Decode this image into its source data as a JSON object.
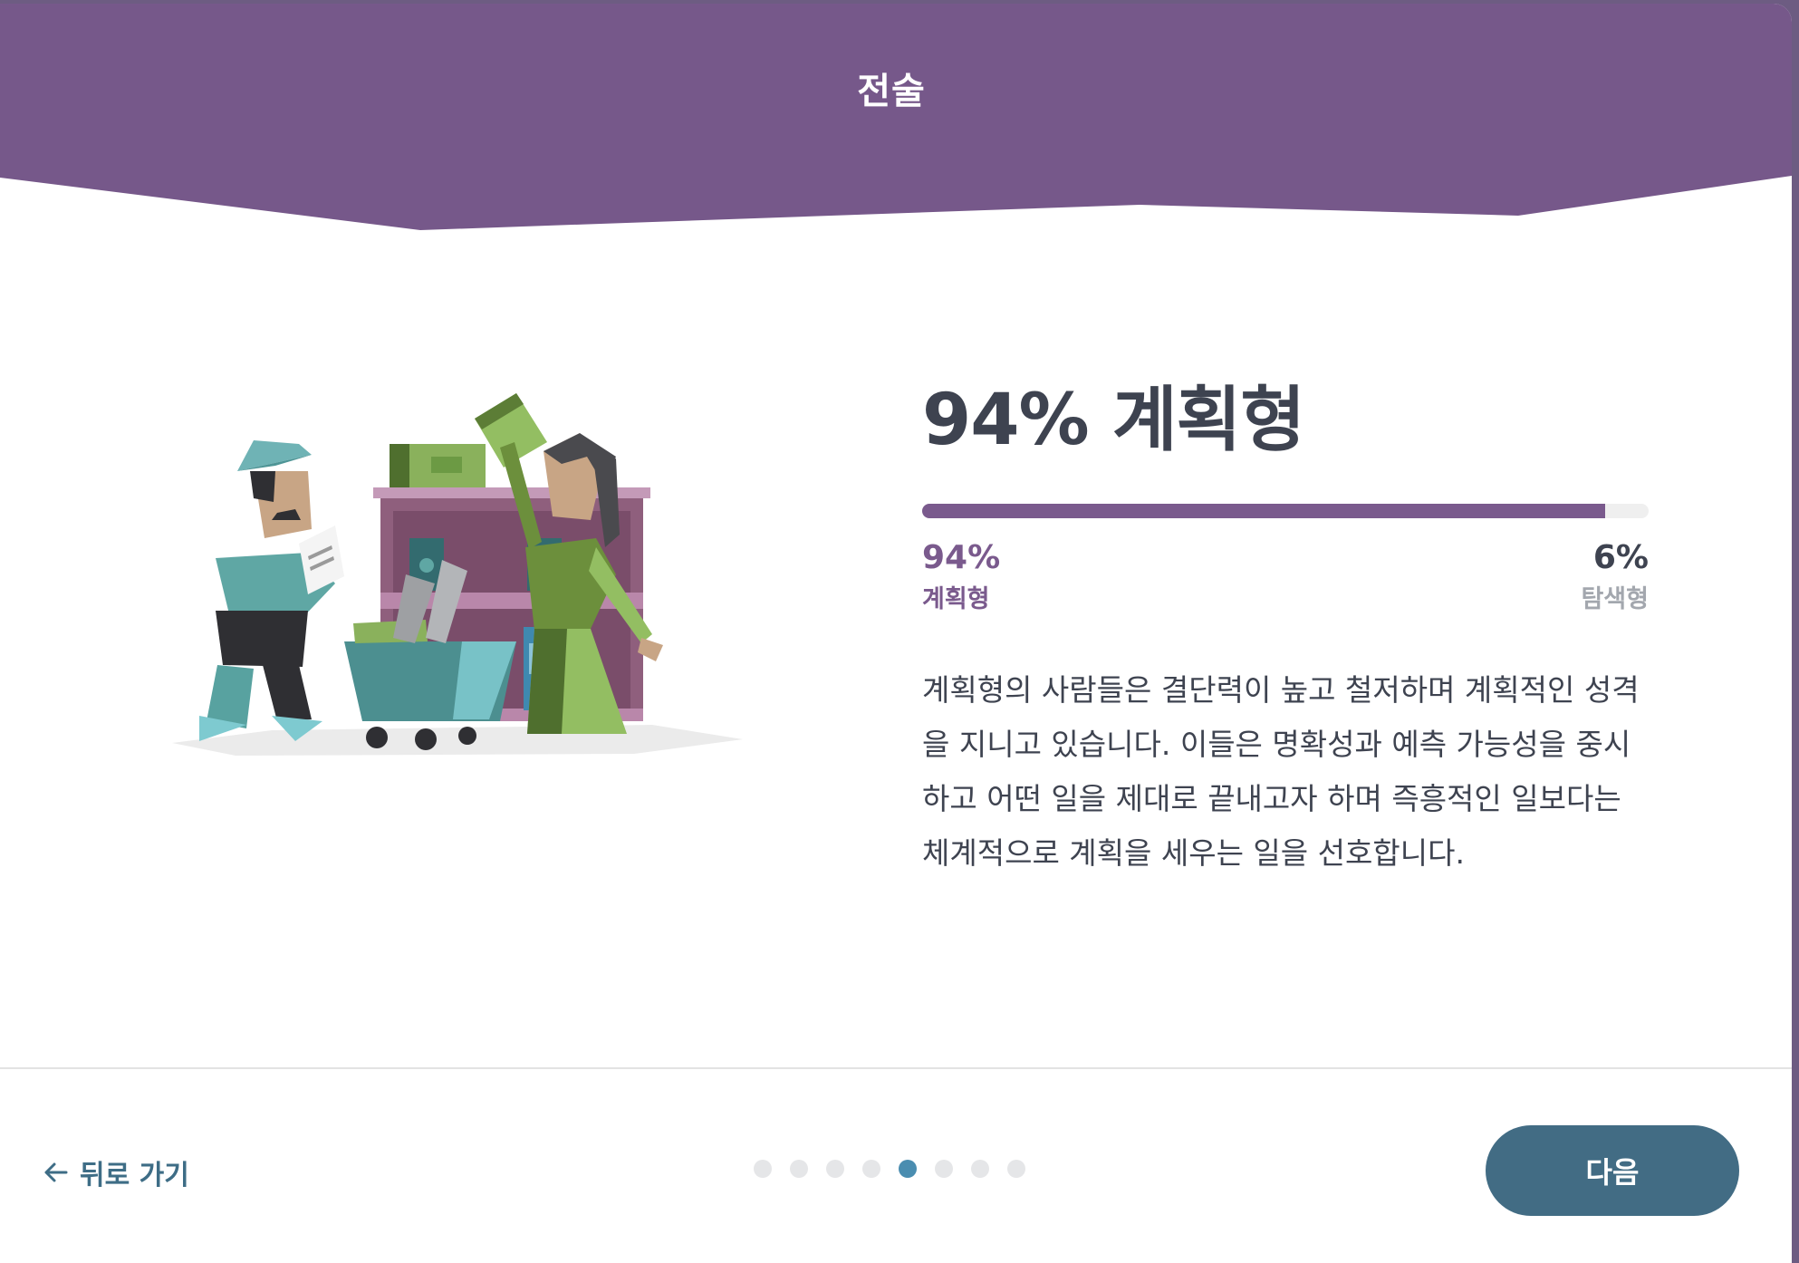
{
  "header": {
    "title": "전술",
    "color": "#76588a"
  },
  "result": {
    "title": "94% 계획형",
    "progress": 0.94,
    "left": {
      "value": "94%",
      "label": "계획형",
      "color": "#7a5a8d"
    },
    "right": {
      "value": "6%",
      "label": "탐색형",
      "color": "#a3a7ae"
    },
    "description": "계획형의 사람들은 결단력이 높고 철저하며 계획적인 성격을 지니고 있습니다. 이들은 명확성과 예측 가능성을 중시하고 어떤 일을 제대로 끝내고자 하며 즉흥적인 일보다는 체계적으로 계획을 세우는 일을 선호합니다."
  },
  "illustration": {
    "icon": "planner-characters-illustration"
  },
  "footer": {
    "back_label": "뒤로 가기",
    "back_icon": "arrow-left-icon",
    "next_label": "다음",
    "pager": {
      "total": 8,
      "current": 5
    },
    "accent": "#426c84"
  }
}
